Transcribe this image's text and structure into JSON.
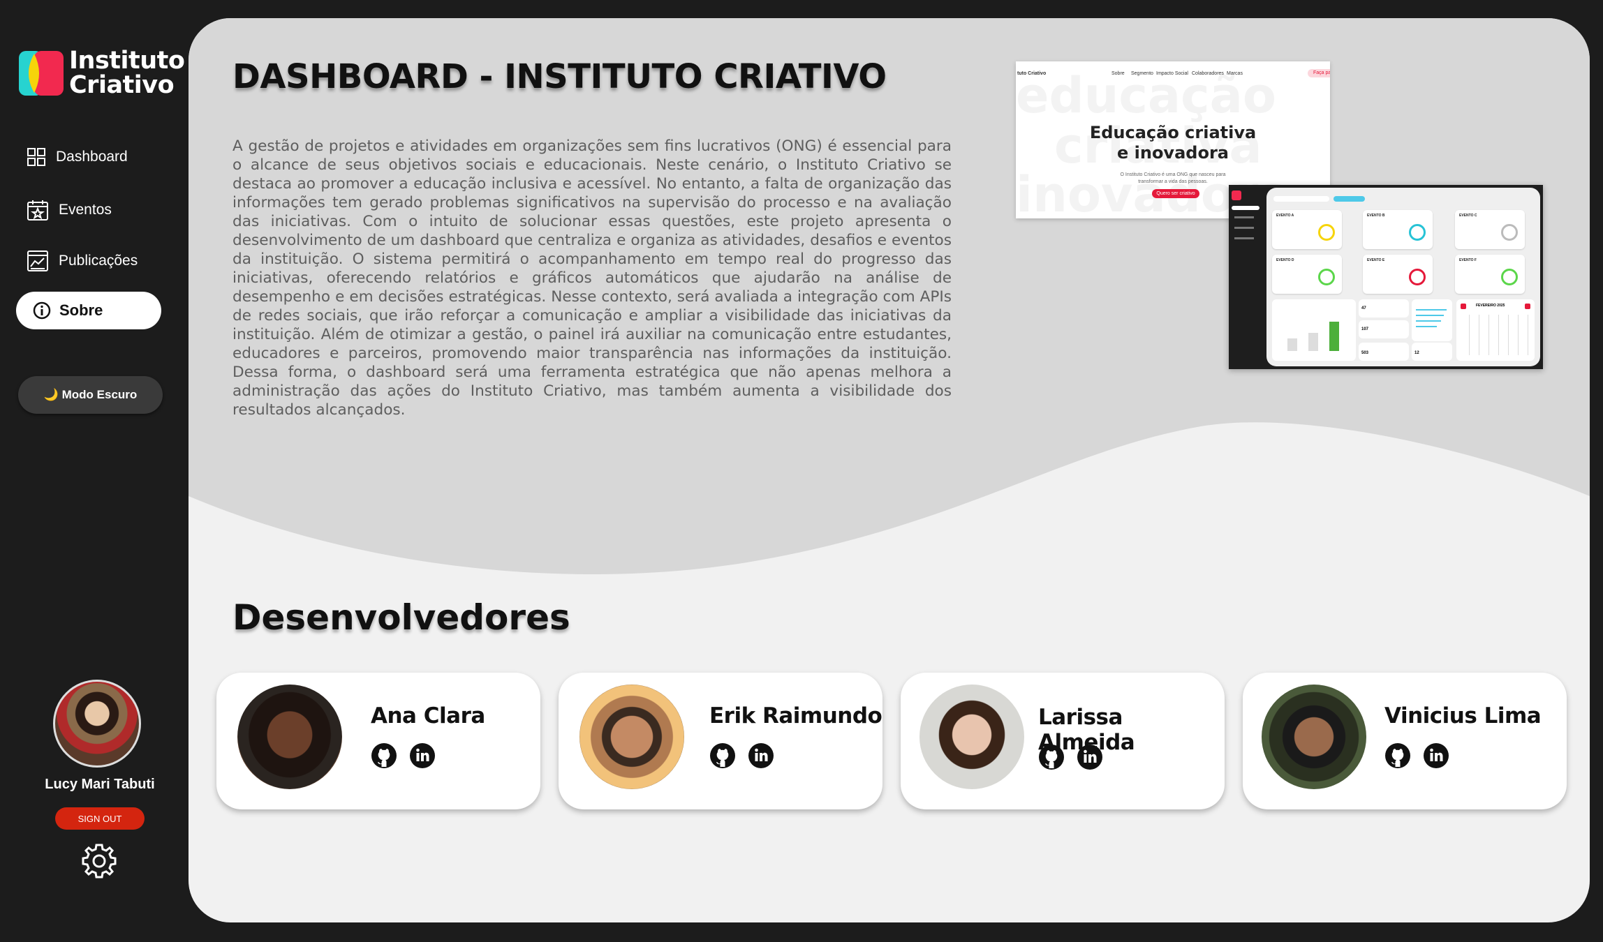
{
  "sidebar": {
    "logo_line1": "Instituto",
    "logo_line2": "Criativo",
    "nav": [
      {
        "label": "Dashboard",
        "icon": "dashboard-icon"
      },
      {
        "label": "Eventos",
        "icon": "calendar-icon"
      },
      {
        "label": "Publicações",
        "icon": "chart-icon"
      },
      {
        "label": "Sobre",
        "icon": "info-icon",
        "active": true
      }
    ],
    "dark_mode_label": "🌙 Modo Escuro",
    "user_name": "Lucy Mari Tabuti",
    "signout_label": "SIGN OUT",
    "settings_icon": "gear-icon"
  },
  "main": {
    "title": "DASHBOARD - INSTITUTO CRIATIVO",
    "intro": "A gestão de projetos e atividades em organizações sem fins lucrativos (ONG) é essencial para o alcance de seus objetivos sociais e educacionais. Neste cenário, o Instituto Criativo se destaca ao promover a educação inclusiva e acessível. No entanto, a falta de organização das informações tem gerado problemas significativos na supervisão do processo e na avaliação das iniciativas. Com o intuito de solucionar essas questões, este projeto apresenta o desenvolvimento de um dashboard que centraliza e organiza as atividades, desafios e eventos da instituição. O sistema permitirá o acompanhamento em tempo real do progresso das iniciativas, oferecendo relatórios e gráficos automáticos que ajudarão na análise de desempenho e em decisões estratégicas. Nesse contexto, será avaliada a integração com APIs de redes sociais, que irão reforçar a comunicação e ampliar a visibilidade das iniciativas da instituição. Além de otimizar a gestão, o painel irá auxiliar na comunicação entre estudantes, educadores e parceiros, promovendo maior transparência nas informações da instituição. Dessa forma, o dashboard será uma ferramenta estratégica que não apenas melhora a administração das ações do Instituto Criativo, mas também aumenta a visibilidade dos resultados alcançados.",
    "site_preview": {
      "brand": "tuto Criativo",
      "nav": [
        "Sobre",
        "Segmento",
        "Impacto Social",
        "Colaboradores",
        "Marcas"
      ],
      "nav_cta": "Faça pa",
      "bg_words": [
        "educação",
        "criativa",
        "inovadora"
      ],
      "hero_line1": "Educação criativa",
      "hero_line2": "e inovadora",
      "sub_line1": "O Instituto Criativo é uma ONG que nasceu para",
      "sub_line2": "transformar a vida das pessoas.",
      "cta": "Quero ser criativo"
    },
    "dash_preview": {
      "cards": [
        "EVENTO A",
        "EVENTO B",
        "EVENTO C",
        "EVENTO D",
        "EVENTO E",
        "EVENTO F"
      ],
      "calendar_title": "FEVEREIRO 2025",
      "stat_values": [
        "47",
        "107",
        "503",
        "12"
      ]
    },
    "developers_title": "Desenvolvedores",
    "developers": [
      {
        "name": "Ana Clara"
      },
      {
        "name": "Erik Raimundo"
      },
      {
        "name": "Larissa Almeida"
      },
      {
        "name": "Vinicius Lima"
      }
    ]
  }
}
